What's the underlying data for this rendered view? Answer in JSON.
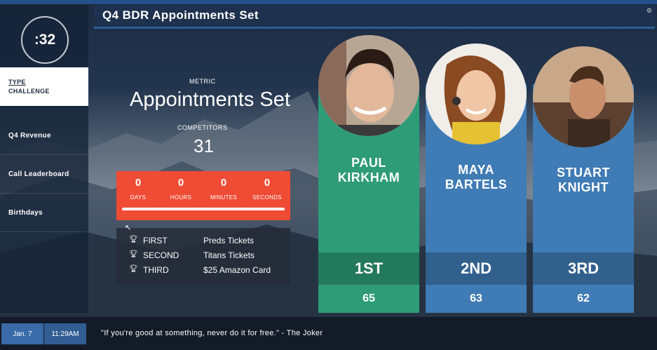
{
  "header": {
    "title": "Q4 BDR Appointments Set"
  },
  "timer": {
    "value": ":32"
  },
  "sidebar": {
    "active": {
      "line1": "Type",
      "line2": "Challenge"
    },
    "items": [
      {
        "label": "Q4 Revenue"
      },
      {
        "label": "Call Leaderboard"
      },
      {
        "label": "Birthdays"
      }
    ]
  },
  "metric": {
    "label": "METRIC",
    "value": "Appointments Set"
  },
  "competitors": {
    "label": "COMPETITORS",
    "value": "31"
  },
  "countdown": {
    "cells": [
      {
        "value": "0",
        "unit": "DAYS"
      },
      {
        "value": "0",
        "unit": "HOURS"
      },
      {
        "value": "0",
        "unit": "MINUTES"
      },
      {
        "value": "0",
        "unit": "SECONDS"
      }
    ]
  },
  "prizes": [
    {
      "place": "FIRST",
      "reward": "Preds Tickets"
    },
    {
      "place": "SECOND",
      "reward": "Titans Tickets"
    },
    {
      "place": "THIRD",
      "reward": "$25 Amazon Card"
    }
  ],
  "leaders": [
    {
      "first": "Paul",
      "last": "Kirkham",
      "rank": "1ST",
      "score": "65",
      "color": "#2e9c77"
    },
    {
      "first": "Maya",
      "last": "Bartels",
      "rank": "2ND",
      "score": "63",
      "color": "#3f7bb5"
    },
    {
      "first": "Stuart",
      "last": "Knight",
      "rank": "3RD",
      "score": "62",
      "color": "#3f7bb5"
    }
  ],
  "ticker": {
    "date": "Jan. 7",
    "time": "11:29AM",
    "quote": "\"If you're good at something, never do it for free.\" - The Joker"
  },
  "icons": {
    "trophy": "trophy-icon",
    "gear": "gear-icon",
    "cursor": "mouse-cursor-icon"
  }
}
